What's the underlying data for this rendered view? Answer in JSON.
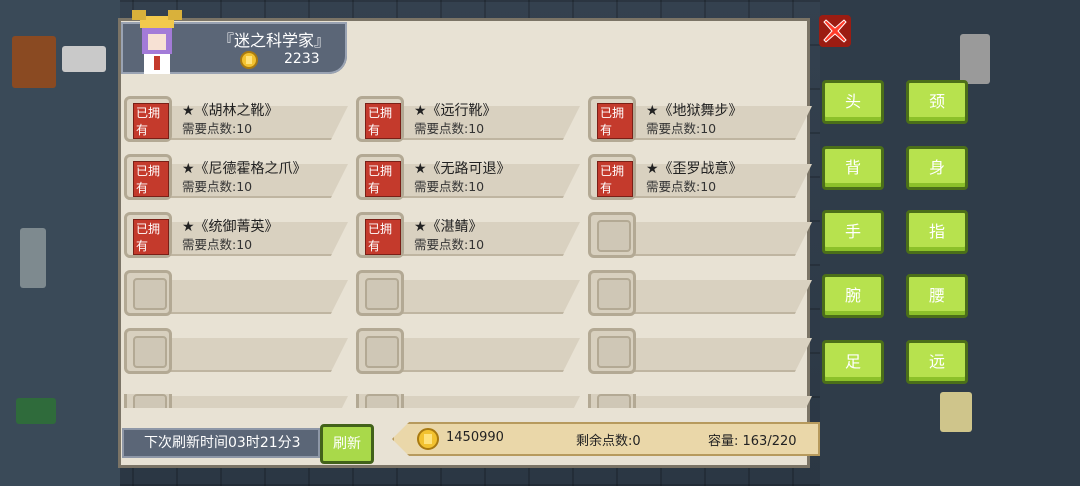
{
  "header": {
    "title": "『迷之科学家』",
    "coins": "2233"
  },
  "owned_label": "已拥有",
  "items": [
    {
      "name": "★《胡林之靴》",
      "need": "需要点数:10",
      "owned": true,
      "color": "#8b6a52"
    },
    {
      "name": "★《远行靴》",
      "need": "需要点数:10",
      "owned": true,
      "color": "#e0a21a"
    },
    {
      "name": "★《地狱舞步》",
      "need": "需要点数:10",
      "owned": true,
      "color": "#8a8f99"
    },
    {
      "name": "★《尼德霍格之爪》",
      "need": "需要点数:10",
      "owned": true,
      "color": "#c7321f"
    },
    {
      "name": "★《无路可退》",
      "need": "需要点数:10",
      "owned": true,
      "color": "#7c7fc2"
    },
    {
      "name": "★《歪罗战意》",
      "need": "需要点数:10",
      "owned": true,
      "color": "#d9822b"
    },
    {
      "name": "★《统御菁英》",
      "need": "需要点数:10",
      "owned": true,
      "color": "#e24a22"
    },
    {
      "name": "★《湛鲭》",
      "need": "需要点数:10",
      "owned": true,
      "color": "#b99b57"
    }
  ],
  "categories": [
    "头",
    "颈",
    "背",
    "身",
    "手",
    "指",
    "腕",
    "腰",
    "足",
    "远"
  ],
  "footer": {
    "refresh_timer": "下次刷新时间03时21分3",
    "refresh_button": "刷新",
    "gold": "1450990",
    "points": "剩余点数:0",
    "capacity": "容量: 163/220"
  },
  "colors": {
    "accent_green": "#b7e24e",
    "panel": "#e8e2d4",
    "owned_badge": "#c43a2c"
  },
  "icons": [
    "close-icon",
    "coin-icon"
  ]
}
